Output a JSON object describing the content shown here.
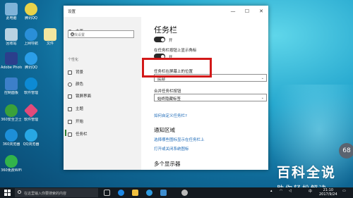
{
  "window": {
    "title": "设置",
    "controls": {
      "minimize": "—",
      "maximize": "☐",
      "close": "✕"
    }
  },
  "sidebar": {
    "home": "主页",
    "search_placeholder": "查找设置",
    "section": "个性化",
    "items": [
      {
        "label": "背景",
        "icon": "picture-icon"
      },
      {
        "label": "颜色",
        "icon": "palette-icon"
      },
      {
        "label": "锁屏界面",
        "icon": "lock-screen-icon"
      },
      {
        "label": "主题",
        "icon": "brush-icon"
      },
      {
        "label": "开始",
        "icon": "start-icon"
      },
      {
        "label": "任务栏",
        "icon": "taskbar-icon"
      }
    ],
    "active_index": 5
  },
  "content": {
    "title": "任务栏",
    "toggle1_label": "开",
    "toggle2_label": "在任务栏按钮上显示角标",
    "toggle2_state": "开",
    "position_label": "任务栏在屏幕上的位置",
    "position_value": "底部",
    "combine_label": "合并任务栏按钮",
    "combine_value": "始终隐藏标签",
    "customize_link": "如何自定义任务栏?",
    "notify_heading": "通知区域",
    "notify_link1": "选择哪些图标显示在任务栏上",
    "notify_link2": "打开或关闭系统图标",
    "multi_heading": "多个显示器"
  },
  "desktop_icons": [
    {
      "label": "此电脑",
      "color": "#7fb3d8"
    },
    {
      "label": "腾讯QQ",
      "color": "#e8d24a"
    },
    {
      "label": "回收站",
      "color": "#b9d2e2"
    },
    {
      "label": "上网导航",
      "color": "#2a8fd8"
    },
    {
      "label": "文件",
      "color": "#f2e6a0"
    },
    {
      "label": "Adobe Photosh",
      "color": "#2b3f8c"
    },
    {
      "label": "腾讯QQ",
      "color": "#2b9ee8"
    },
    {
      "label": "控制面板",
      "color": "#3c7fc9"
    },
    {
      "label": "软件管理",
      "color": "#0d8ad4"
    },
    {
      "label": "360安全卫士",
      "color": "#3aa13a"
    },
    {
      "label": "软件管理",
      "color": "#e24a7a"
    },
    {
      "label": "360浏览器",
      "color": "#1d8fd8"
    },
    {
      "label": "QQ浏览器",
      "color": "#28a7e4"
    },
    {
      "label": "360免费WiFi",
      "color": "#32b34a"
    }
  ],
  "watermark": {
    "line1": "百科全说",
    "line2": "助你轻松解决"
  },
  "badge": "68",
  "taskbar": {
    "search_placeholder": "在这里输入你要搜索的内容",
    "time": "21:10",
    "date": "2017/9/24",
    "lang": "中"
  }
}
